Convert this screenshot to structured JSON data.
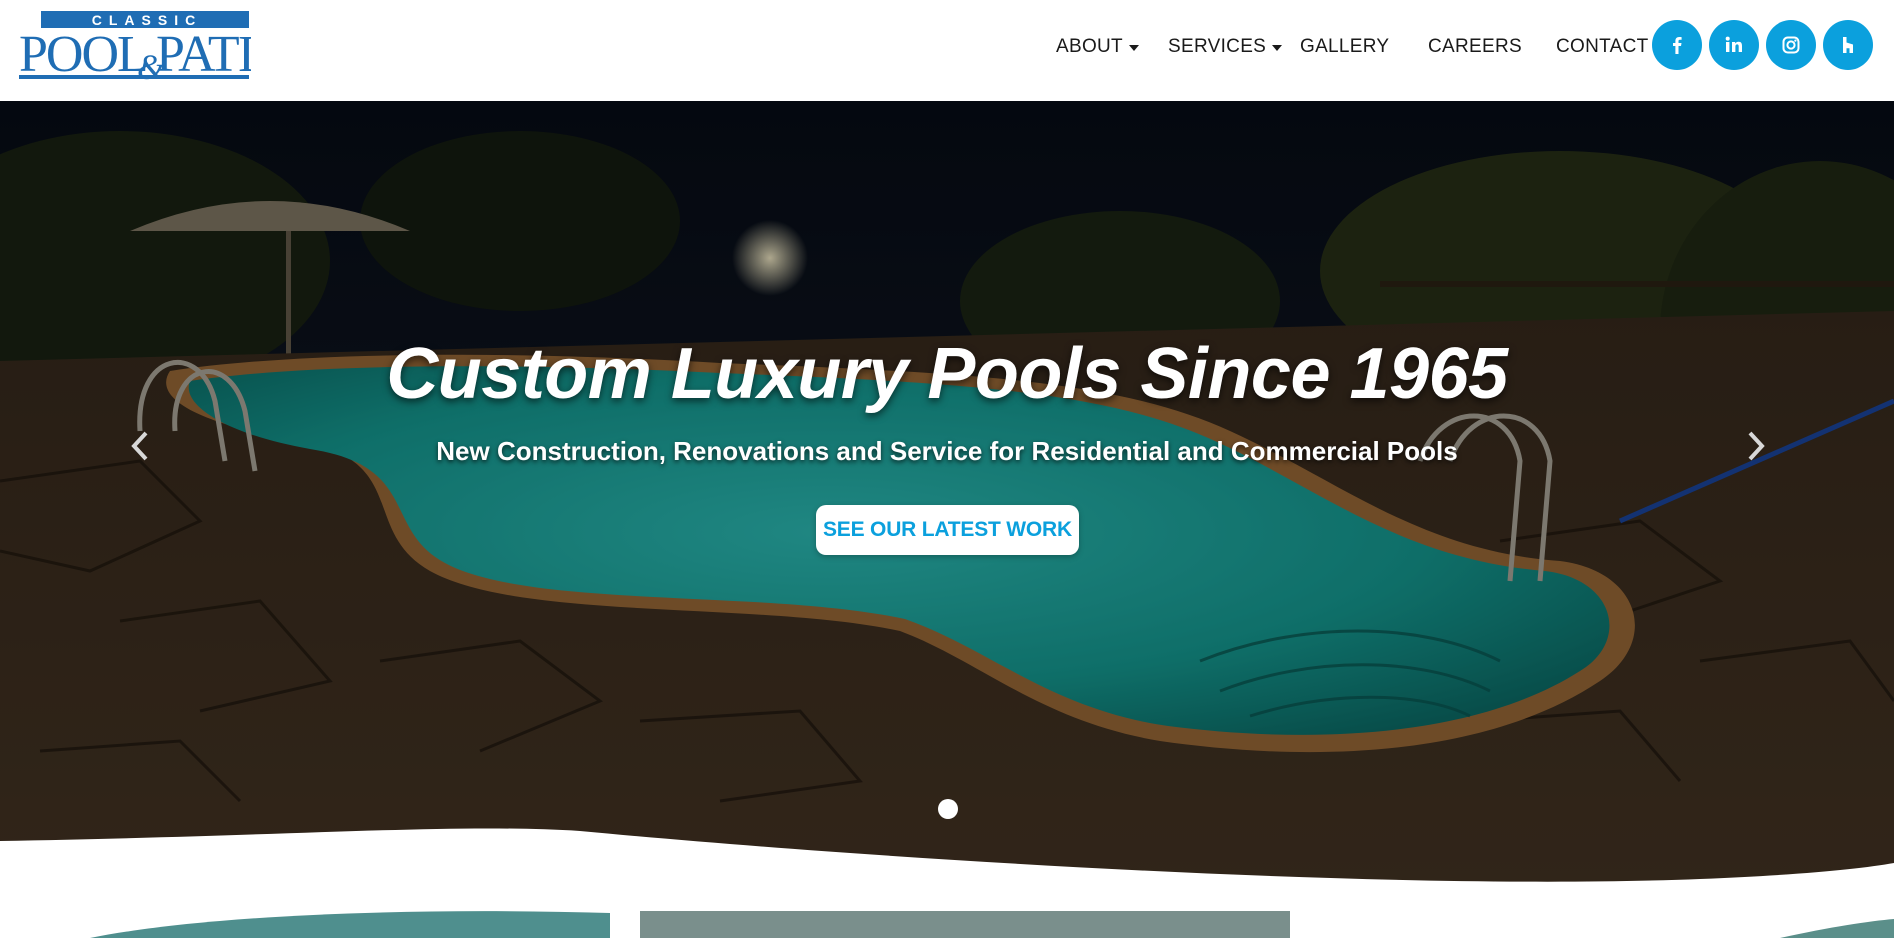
{
  "brand": {
    "logo_top": "CLASSIC",
    "logo_main_left": "POOL",
    "logo_amp": "&",
    "logo_main_right": "PATIO",
    "logo_color": "#1f6db4"
  },
  "nav": {
    "items": [
      {
        "label": "ABOUT",
        "dropdown": true
      },
      {
        "label": "SERVICES",
        "dropdown": true
      },
      {
        "label": "GALLERY",
        "dropdown": false
      },
      {
        "label": "CAREERS",
        "dropdown": false
      },
      {
        "label": "CONTACT",
        "dropdown": false
      }
    ]
  },
  "social": {
    "color": "#0ba0dd",
    "icons": [
      "facebook-icon",
      "linkedin-icon",
      "instagram-icon",
      "houzz-icon"
    ]
  },
  "hero": {
    "headline": "Custom Luxury Pools Since 1965",
    "subline": "New Construction, Renovations and Service for Residential and Commercial Pools",
    "cta_label": "SEE OUR LATEST WORK",
    "cta_color": "#0ba0dd",
    "slide_count": 1,
    "active_slide": 1
  }
}
